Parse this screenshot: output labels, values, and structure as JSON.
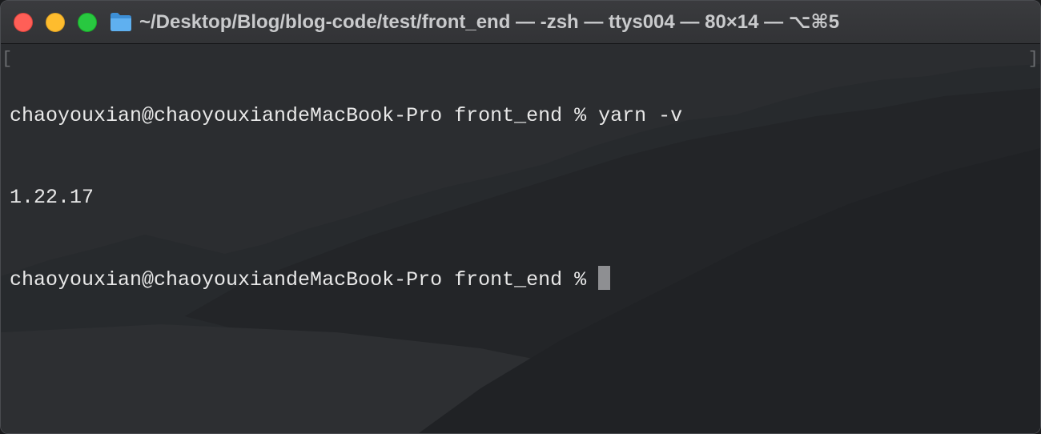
{
  "window": {
    "title": "~/Desktop/Blog/blog-code/test/front_end — -zsh — ttys004 — 80×14 — ⌥⌘5",
    "title_icon": "folder-icon",
    "traffic_lights": {
      "close_color": "#ff5f57",
      "minimize_color": "#febc2e",
      "zoom_color": "#28c840"
    }
  },
  "terminal": {
    "lines": [
      "chaoyouxian@chaoyouxiandeMacBook-Pro front_end % yarn -v",
      "1.22.17"
    ],
    "prompt": "chaoyouxian@chaoyouxiandeMacBook-Pro front_end % ",
    "bracket_left": "[",
    "bracket_right": "]"
  }
}
